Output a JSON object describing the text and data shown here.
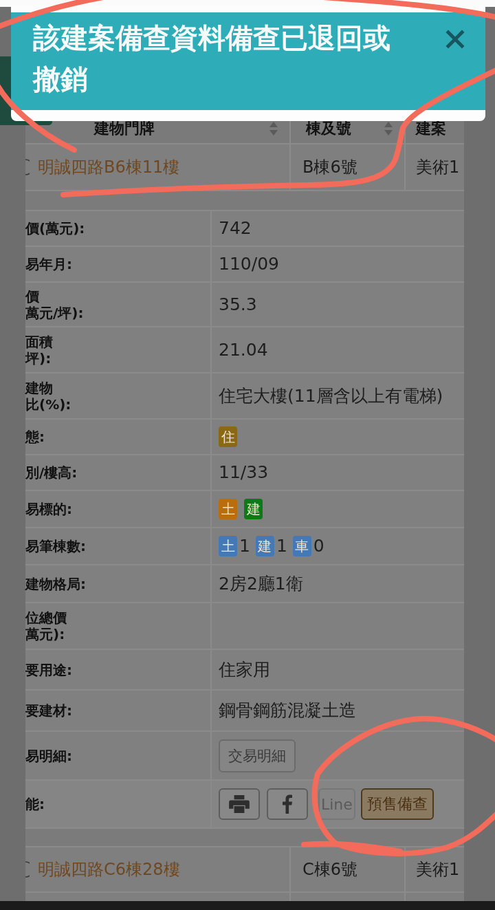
{
  "toast": {
    "message": "該建案備查資料備查已退回或撤銷"
  },
  "listing": {
    "columns": [
      {
        "label": "建物門牌",
        "sortable": true
      },
      {
        "label": "棟及號",
        "sortable": true
      },
      {
        "label": "建案",
        "sortable": false
      }
    ],
    "rows": [
      {
        "selected": false,
        "expanded": true,
        "cells": [
          "明誠四路B6棟11樓",
          "B棟6號",
          "美術1"
        ],
        "details": [
          {
            "kind": "text",
            "label": [
              "價(萬元):"
            ],
            "value": "742"
          },
          {
            "kind": "text",
            "label": [
              "易年月:"
            ],
            "value": "110/09"
          },
          {
            "kind": "text",
            "label": [
              "價",
              "萬元/坪):"
            ],
            "value": "35.3"
          },
          {
            "kind": "text",
            "label": [
              "面積",
              "坪):"
            ],
            "value": "21.04"
          },
          {
            "kind": "text",
            "label": [
              "建物",
              "比(%):"
            ],
            "value": "住宅大樓(11層含以上有電梯)"
          },
          {
            "kind": "tags",
            "label": [
              "態:"
            ],
            "tags": [
              {
                "label": "住",
                "color": "#8b6914"
              }
            ]
          },
          {
            "kind": "text",
            "label": [
              "別/樓高:"
            ],
            "value": "11/33"
          },
          {
            "kind": "tags",
            "label": [
              "易標的:"
            ],
            "tags": [
              {
                "label": "土",
                "color": "#b96d0c"
              },
              {
                "label": "建",
                "color": "#0e7a14"
              }
            ]
          },
          {
            "kind": "counts",
            "label": [
              "易筆棟數:"
            ],
            "counts": [
              {
                "tag": "土",
                "count": "1",
                "color": "#4479b5"
              },
              {
                "tag": "建",
                "count": "1",
                "color": "#4479b5"
              },
              {
                "tag": "車",
                "count": "0",
                "color": "#4479b5"
              }
            ]
          },
          {
            "kind": "text",
            "label": [
              "建物格局:"
            ],
            "value": "2房2廳1衛"
          },
          {
            "kind": "text",
            "label": [
              "位總價",
              "萬元):"
            ]
          },
          {
            "kind": "text",
            "label": [
              "要用途:"
            ],
            "value": "住家用"
          },
          {
            "kind": "text",
            "label": [
              "要建材:"
            ],
            "value": "鋼骨鋼筋混凝土造"
          },
          {
            "kind": "button",
            "label": [
              "易明細:"
            ],
            "button": "交易明細"
          },
          {
            "kind": "actions",
            "label": [
              "能:"
            ],
            "actions": [
              {
                "kind": "print"
              },
              {
                "kind": "facebook"
              },
              {
                "kind": "line",
                "label": "Line"
              },
              {
                "kind": "presale",
                "label": "預售備查"
              }
            ]
          }
        ]
      },
      {
        "selected": false,
        "expanded": false,
        "cells": [
          "明誠四路C6棟28樓",
          "C棟6號",
          "美術1"
        ]
      }
    ]
  }
}
